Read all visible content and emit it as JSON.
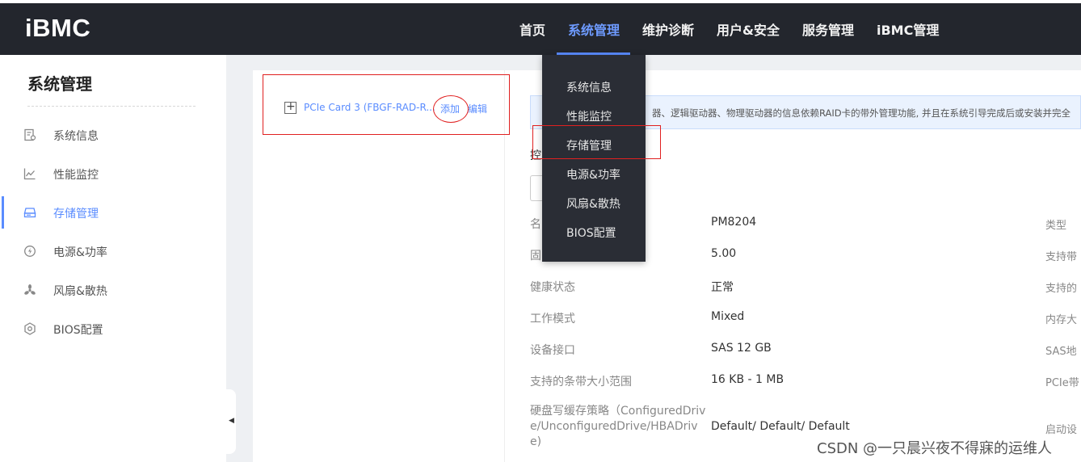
{
  "header": {
    "logo": "iBMC",
    "nav": [
      "首页",
      "系统管理",
      "维护诊断",
      "用户&安全",
      "服务管理",
      "iBMC管理"
    ],
    "active_nav": "系统管理"
  },
  "sidebar": {
    "title": "系统管理",
    "items": [
      {
        "label": "系统信息",
        "icon": "system-info-icon"
      },
      {
        "label": "性能监控",
        "icon": "chart-icon"
      },
      {
        "label": "存储管理",
        "icon": "storage-icon",
        "active": true
      },
      {
        "label": "电源&功率",
        "icon": "power-icon"
      },
      {
        "label": "风扇&散热",
        "icon": "fan-icon"
      },
      {
        "label": "BIOS配置",
        "icon": "bios-icon"
      }
    ]
  },
  "dropdown": {
    "items": [
      "系统信息",
      "性能监控",
      "存储管理",
      "电源&功率",
      "风扇&散热",
      "BIOS配置"
    ]
  },
  "card_tree": {
    "name": "PCIe Card 3 (FBGF-RAD-R...",
    "add": "添加",
    "edit": "编辑"
  },
  "notice": {
    "text": "器、逻辑驱动器、物理驱动器的信息依赖RAID卡的带外管理功能, 并且在系统引导完成后或安装并完全"
  },
  "controller": {
    "label": "控",
    "rows": [
      {
        "label": "名",
        "value": "PM8204",
        "right": "类型"
      },
      {
        "label": "固",
        "value": "5.00",
        "right": "支持带"
      },
      {
        "label": "健康状态",
        "value": "正常",
        "right": "支持的"
      },
      {
        "label": "工作模式",
        "value": "Mixed",
        "right": "内存大"
      },
      {
        "label": "设备接口",
        "value": "SAS 12 GB",
        "right": "SAS地"
      },
      {
        "label": "支持的条带大小范围",
        "value": "16 KB - 1 MB",
        "right": "PCIe带"
      }
    ],
    "write_cache": {
      "label": "硬盘写缓存策略（ConfiguredDrive/UnconfiguredDrive/HBADrive)",
      "value": "Default/ Default/ Default",
      "right": "启动设"
    }
  },
  "watermark": "CSDN @一只晨兴夜不得寐的运维人",
  "colors": {
    "accent": "#5a8cff",
    "topbar": "#23262d",
    "annotation": "#e02020"
  }
}
